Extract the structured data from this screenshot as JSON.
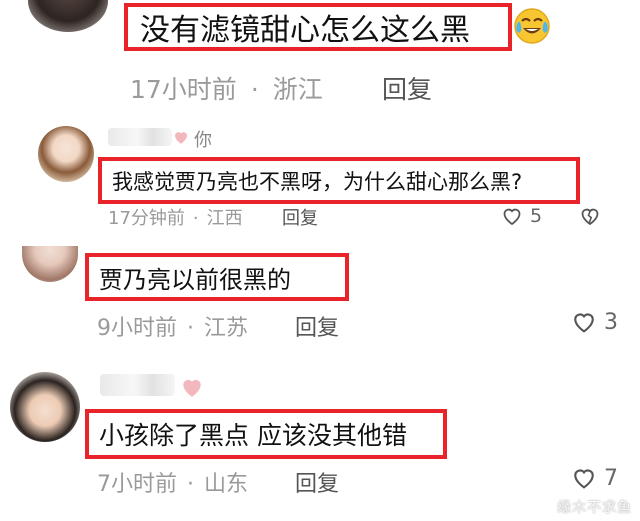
{
  "comments": [
    {
      "text": "没有滤镜甜心怎么这么黑",
      "emoji": "crying-laughing-emoji",
      "time": "17小时前",
      "location": "浙江",
      "reply_label": "回复"
    },
    {
      "suffix": "你",
      "text": "我感觉贾乃亮也不黑呀，为什么甜心那么黑?",
      "time": "17分钟前",
      "location": "江西",
      "reply_label": "回复",
      "likes": "5"
    },
    {
      "text": "贾乃亮以前很黑的",
      "time": "9小时前",
      "location": "江苏",
      "reply_label": "回复",
      "likes": "3"
    },
    {
      "text": "小孩除了黑点 应该没其他错",
      "time": "7小时前",
      "location": "山东",
      "reply_label": "回复",
      "likes": "7"
    }
  ],
  "separator": "·",
  "watermark": "缘木不求鱼",
  "colors": {
    "highlight": "#e8232a",
    "meta": "#9a9a9a",
    "heart_pink": "#f3b8be"
  }
}
